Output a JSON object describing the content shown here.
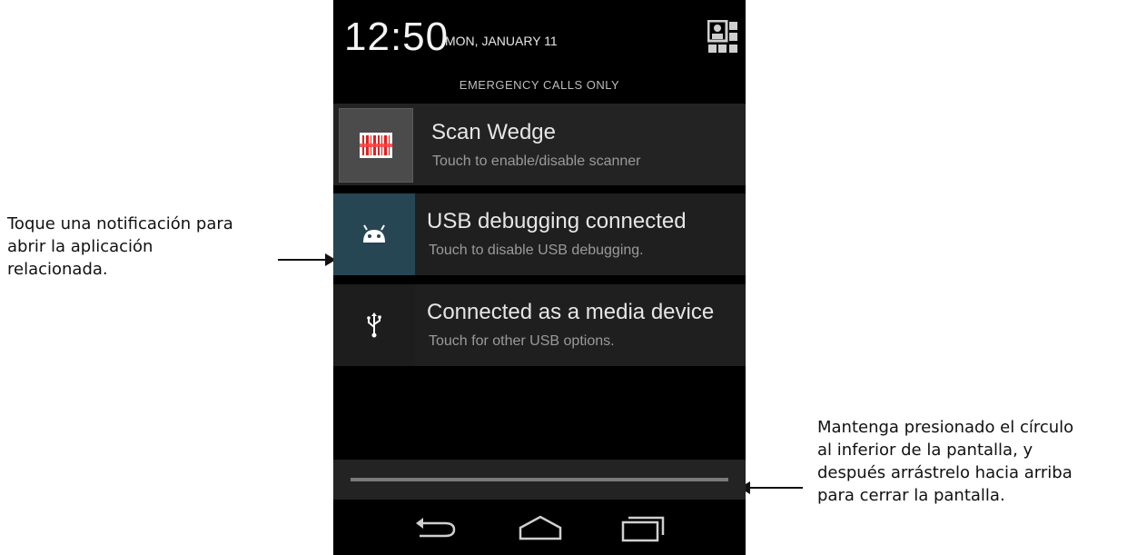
{
  "annotations": {
    "left_lines": [
      "Toque una notificación para",
      "abrir la aplicación",
      "relacionada."
    ],
    "right_lines": [
      "Mantenga presionado el círculo",
      "al inferior de la pantalla, y",
      "después arrástrelo hacia arriba",
      "para cerrar la pantalla."
    ]
  },
  "status": {
    "time": "12:50",
    "date": "MON, JANUARY 11",
    "quick_settings_icon": "user-grid-icon",
    "carrier": "EMERGENCY CALLS ONLY"
  },
  "notifications": [
    {
      "title": "Scan Wedge",
      "subtitle": "Touch to enable/disable scanner",
      "icon": "barcode-icon"
    },
    {
      "title": "USB debugging connected",
      "subtitle": "Touch to disable USB debugging.",
      "icon": "android-icon"
    },
    {
      "title": "Connected as a media device",
      "subtitle": "Touch for other USB options.",
      "icon": "usb-icon"
    }
  ],
  "navigation": {
    "back_icon": "back-icon",
    "home_icon": "home-icon",
    "recent_icon": "recent-apps-icon"
  },
  "colors": {
    "background": "#000000",
    "notification_bg": "#1f1f1f",
    "usb_debug_icon_bg": "#264653",
    "barcode_red": "#e02020"
  }
}
